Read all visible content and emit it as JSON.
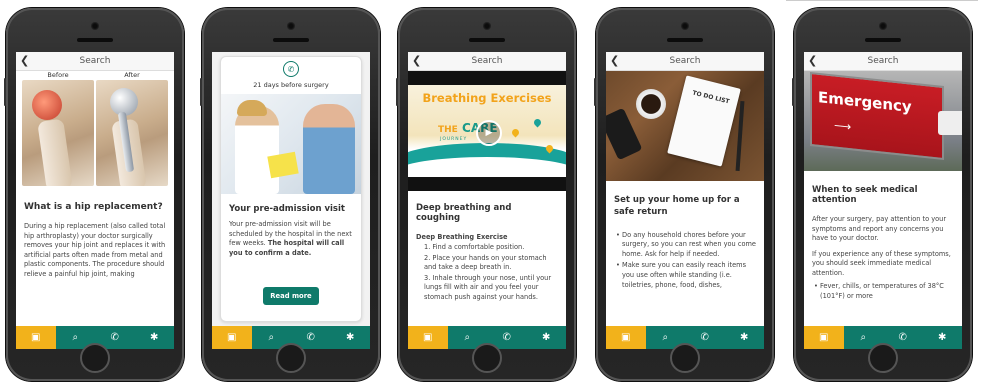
{
  "screens": [
    {
      "topbar": {
        "title": "Search"
      },
      "image": {
        "before_label": "Before",
        "after_label": "After"
      },
      "heading": "What is a hip replacement?",
      "body": "During a hip replacement (also called total hip arthroplasty) your doctor surgically removes your hip joint and replaces it with artificial parts often made from metal and plastic components. The procedure should relieve a painful hip joint, making"
    },
    {
      "days": "21 days before surgery",
      "heading": "Your pre-admission visit",
      "body_plain": "Your pre-admission visit will be scheduled by the hospital in the next few weeks.",
      "body_bold": "The hospital will call you to confirm a date.",
      "button": "Read more"
    },
    {
      "topbar": {
        "title": "Search"
      },
      "video": {
        "title": "Breathing Exercises",
        "logo": "CARE",
        "logo_prefix": "THE",
        "logo_sub": "JOURNEY"
      },
      "heading": "Deep breathing and coughing",
      "subheading": "Deep Breathing Exercise",
      "steps": [
        "1. Find a comfortable position.",
        "2. Place your hands on your stomach and take a deep breath in.",
        "3. Inhale through your nose, until your lungs fill with air and you feel your stomach push against your hands."
      ]
    },
    {
      "topbar": {
        "title": "Search"
      },
      "image": {
        "notebook_text": "TO DO LIST"
      },
      "heading": "Set up your home up for a safe return",
      "bullets": [
        "Do any household chores before your surgery, so you can rest when you come home. Ask for help if needed.",
        "Make sure you can easily reach items you use often while standing (i.e. toiletries, phone, food, dishes,"
      ]
    },
    {
      "topbar": {
        "title": "Search"
      },
      "image": {
        "sign_text": "Emergency",
        "arrow": "⟶"
      },
      "heading": "When to seek medical attention",
      "body1": "After your surgery, pay attention to your symptoms and report any concerns you have to your doctor.",
      "body2": "If you experience any of these symptoms, you should seek immediate medical attention.",
      "bullets": [
        "Fever, chills, or temperatures of 38°C (101°F) or more"
      ]
    }
  ],
  "tabbar": {
    "icons": [
      "briefcase-icon",
      "search-icon",
      "phone-icon",
      "gear-icon"
    ],
    "glyphs": [
      "▣",
      "⌕",
      "✆",
      "✱"
    ]
  },
  "colors": {
    "accent": "#0f7a6a",
    "active_tab": "#f2b21b",
    "emergency_red": "#c81d25",
    "title_orange": "#f2a31b"
  }
}
